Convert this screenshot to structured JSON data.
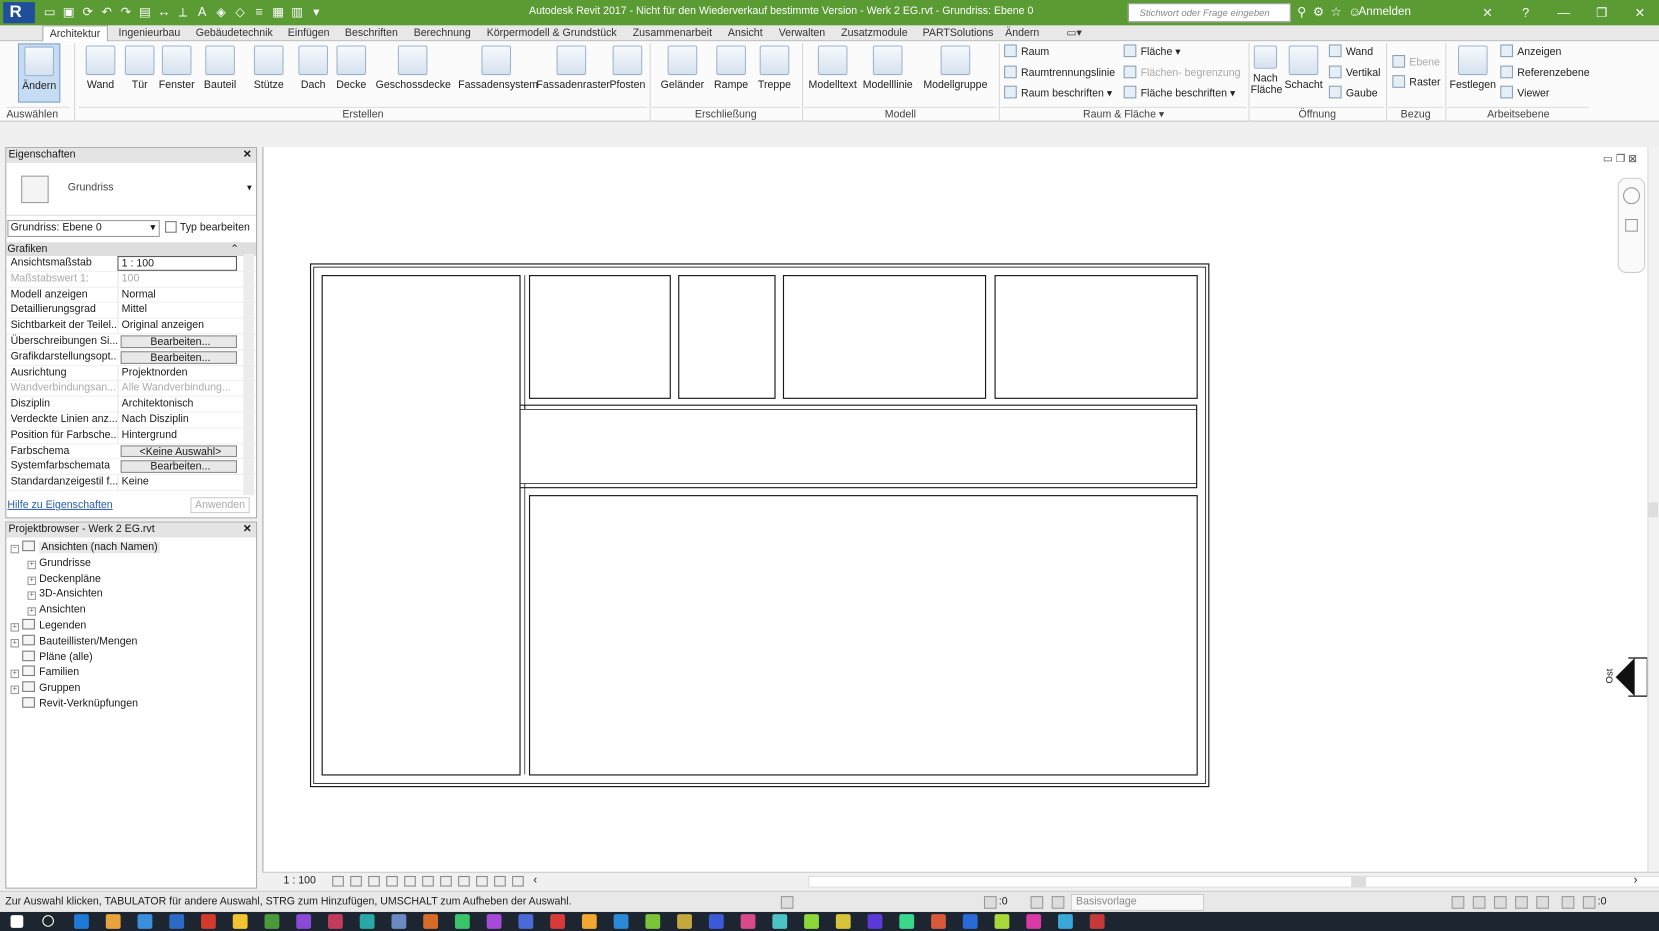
{
  "app": {
    "logo": "R",
    "title": "Autodesk Revit 2017 - Nicht für den Wiederverkauf bestimmte Version -    Werk 2 EG.rvt - Grundriss: Ebene 0",
    "search_placeholder": "Stichwort oder Frage eingeben",
    "login": "Anmelden"
  },
  "tabs": [
    "Architektur",
    "Ingenieurbau",
    "Gebäudetechnik",
    "Einfügen",
    "Beschriften",
    "Berechnung",
    "Körpermodell & Grundstück",
    "Zusammenarbeit",
    "Ansicht",
    "Verwalten",
    "Zusatzmodule",
    "PARTSolutions",
    "Ändern"
  ],
  "ribbon": {
    "select": {
      "modify": "Ändern",
      "auswaehlen": "Auswählen"
    },
    "create": {
      "wand": "Wand",
      "tuer": "Tür",
      "fenster": "Fenster",
      "bauteil": "Bauteil",
      "stuetze": "Stütze",
      "dach": "Dach",
      "decke": "Decke",
      "geschossdecke": "Geschossdecke",
      "fassadensystem": "Fassadensystem",
      "fassadenraster": "Fassadenraster",
      "pfosten": "Pfosten",
      "group": "Erstellen"
    },
    "circulation": {
      "gelaender": "Geländer",
      "rampe": "Rampe",
      "treppe": "Treppe",
      "group": "Erschließung"
    },
    "model": {
      "modelltext": "Modelltext",
      "modelllinie": "Modelllinie",
      "modellgruppe": "Modellgruppe",
      "group": "Modell"
    },
    "room": {
      "raum": "Raum",
      "raumtrennung": "Raumtrennungslinie",
      "raum_beschriften": "Raum  beschriften",
      "flaeche": "Fläche",
      "flaechen_begrenzung": "Flächen- begrenzung",
      "flaeche_beschriften": "Fläche  beschriften",
      "group": "Raum & Fläche"
    },
    "opening": {
      "nach": "Nach",
      "flaeche": "Fläche",
      "schacht": "Schacht",
      "wand": "Wand",
      "vertikal": "Vertikal",
      "gaube": "Gaube",
      "group": "Öffnung"
    },
    "datum": {
      "ebene": "Ebene",
      "raster": "Raster",
      "group": "Bezug"
    },
    "workplane": {
      "festlegen": "Festlegen",
      "anzeigen": "Anzeigen",
      "referenzebene": "Referenzebene",
      "viewer": "Viewer",
      "group": "Arbeitsebene"
    }
  },
  "properties": {
    "title": "Eigenschaften",
    "type_name": "Grundriss",
    "instance": "Grundriss: Ebene 0",
    "edit_type": "Typ bearbeiten",
    "category": "Grafiken",
    "rows": [
      {
        "k": "Ansichtsmaßstab",
        "v": "1 : 100",
        "style": "box"
      },
      {
        "k": "Maßstabswert 1:",
        "v": "100",
        "style": "dis"
      },
      {
        "k": "Modell anzeigen",
        "v": "Normal",
        "style": ""
      },
      {
        "k": "Detaillierungsgrad",
        "v": "Mittel",
        "style": ""
      },
      {
        "k": "Sichtbarkeit der Teilel...",
        "v": "Original anzeigen",
        "style": ""
      },
      {
        "k": "Überschreibungen Si...",
        "v": "Bearbeiten...",
        "style": "btn"
      },
      {
        "k": "Grafikdarstellungsopt...",
        "v": "Bearbeiten...",
        "style": "btn"
      },
      {
        "k": "Ausrichtung",
        "v": "Projektnorden",
        "style": ""
      },
      {
        "k": "Wandverbindungsan...",
        "v": "Alle Wandverbindung...",
        "style": "dis"
      },
      {
        "k": "Disziplin",
        "v": "Architektonisch",
        "style": ""
      },
      {
        "k": "Verdeckte Linien anz...",
        "v": "Nach Disziplin",
        "style": ""
      },
      {
        "k": "Position für Farbsche...",
        "v": "Hintergrund",
        "style": ""
      },
      {
        "k": "Farbschema",
        "v": "<Keine Auswahl>",
        "style": "btn"
      },
      {
        "k": "Systemfarbschemata",
        "v": "Bearbeiten...",
        "style": "btn"
      },
      {
        "k": "Standardanzeigestil f...",
        "v": "Keine",
        "style": ""
      }
    ],
    "help": "Hilfe zu Eigenschaften",
    "apply": "Anwenden"
  },
  "browser": {
    "title": "Projektbrowser - Werk 2 EG.rvt",
    "nodes": [
      {
        "label": "Ansichten (nach Namen)",
        "level": 0,
        "exp": "−"
      },
      {
        "label": "Grundrisse",
        "level": 1,
        "exp": "+"
      },
      {
        "label": "Deckenpläne",
        "level": 1,
        "exp": "+"
      },
      {
        "label": "3D-Ansichten",
        "level": 1,
        "exp": "+"
      },
      {
        "label": "Ansichten",
        "level": 1,
        "exp": "+"
      },
      {
        "label": "Legenden",
        "level": 0,
        "exp": "+"
      },
      {
        "label": "Bauteillisten/Mengen",
        "level": 0,
        "exp": "+"
      },
      {
        "label": "Pläne (alle)",
        "level": 0,
        "exp": ""
      },
      {
        "label": "Familien",
        "level": 0,
        "exp": "+"
      },
      {
        "label": "Gruppen",
        "level": 0,
        "exp": "+"
      },
      {
        "label": "Revit-Verknüpfungen",
        "level": 0,
        "exp": ""
      }
    ]
  },
  "view": {
    "scale": "1 : 100",
    "elevation_label": "Ost"
  },
  "status": {
    "message": "Zur Auswahl klicken, TABULATOR für andere Auswahl, STRG zum Hinzufügen, UMSCHALT zum Aufheben der Auswahl.",
    "zero": ":0",
    "zero2": ":0",
    "base": "Basisvorlage"
  },
  "colors": {
    "titlebar": "#5a9b34",
    "active_tab": "#ffffff",
    "ribbon": "#fbfbfb",
    "wall": "#1a1a1a"
  }
}
